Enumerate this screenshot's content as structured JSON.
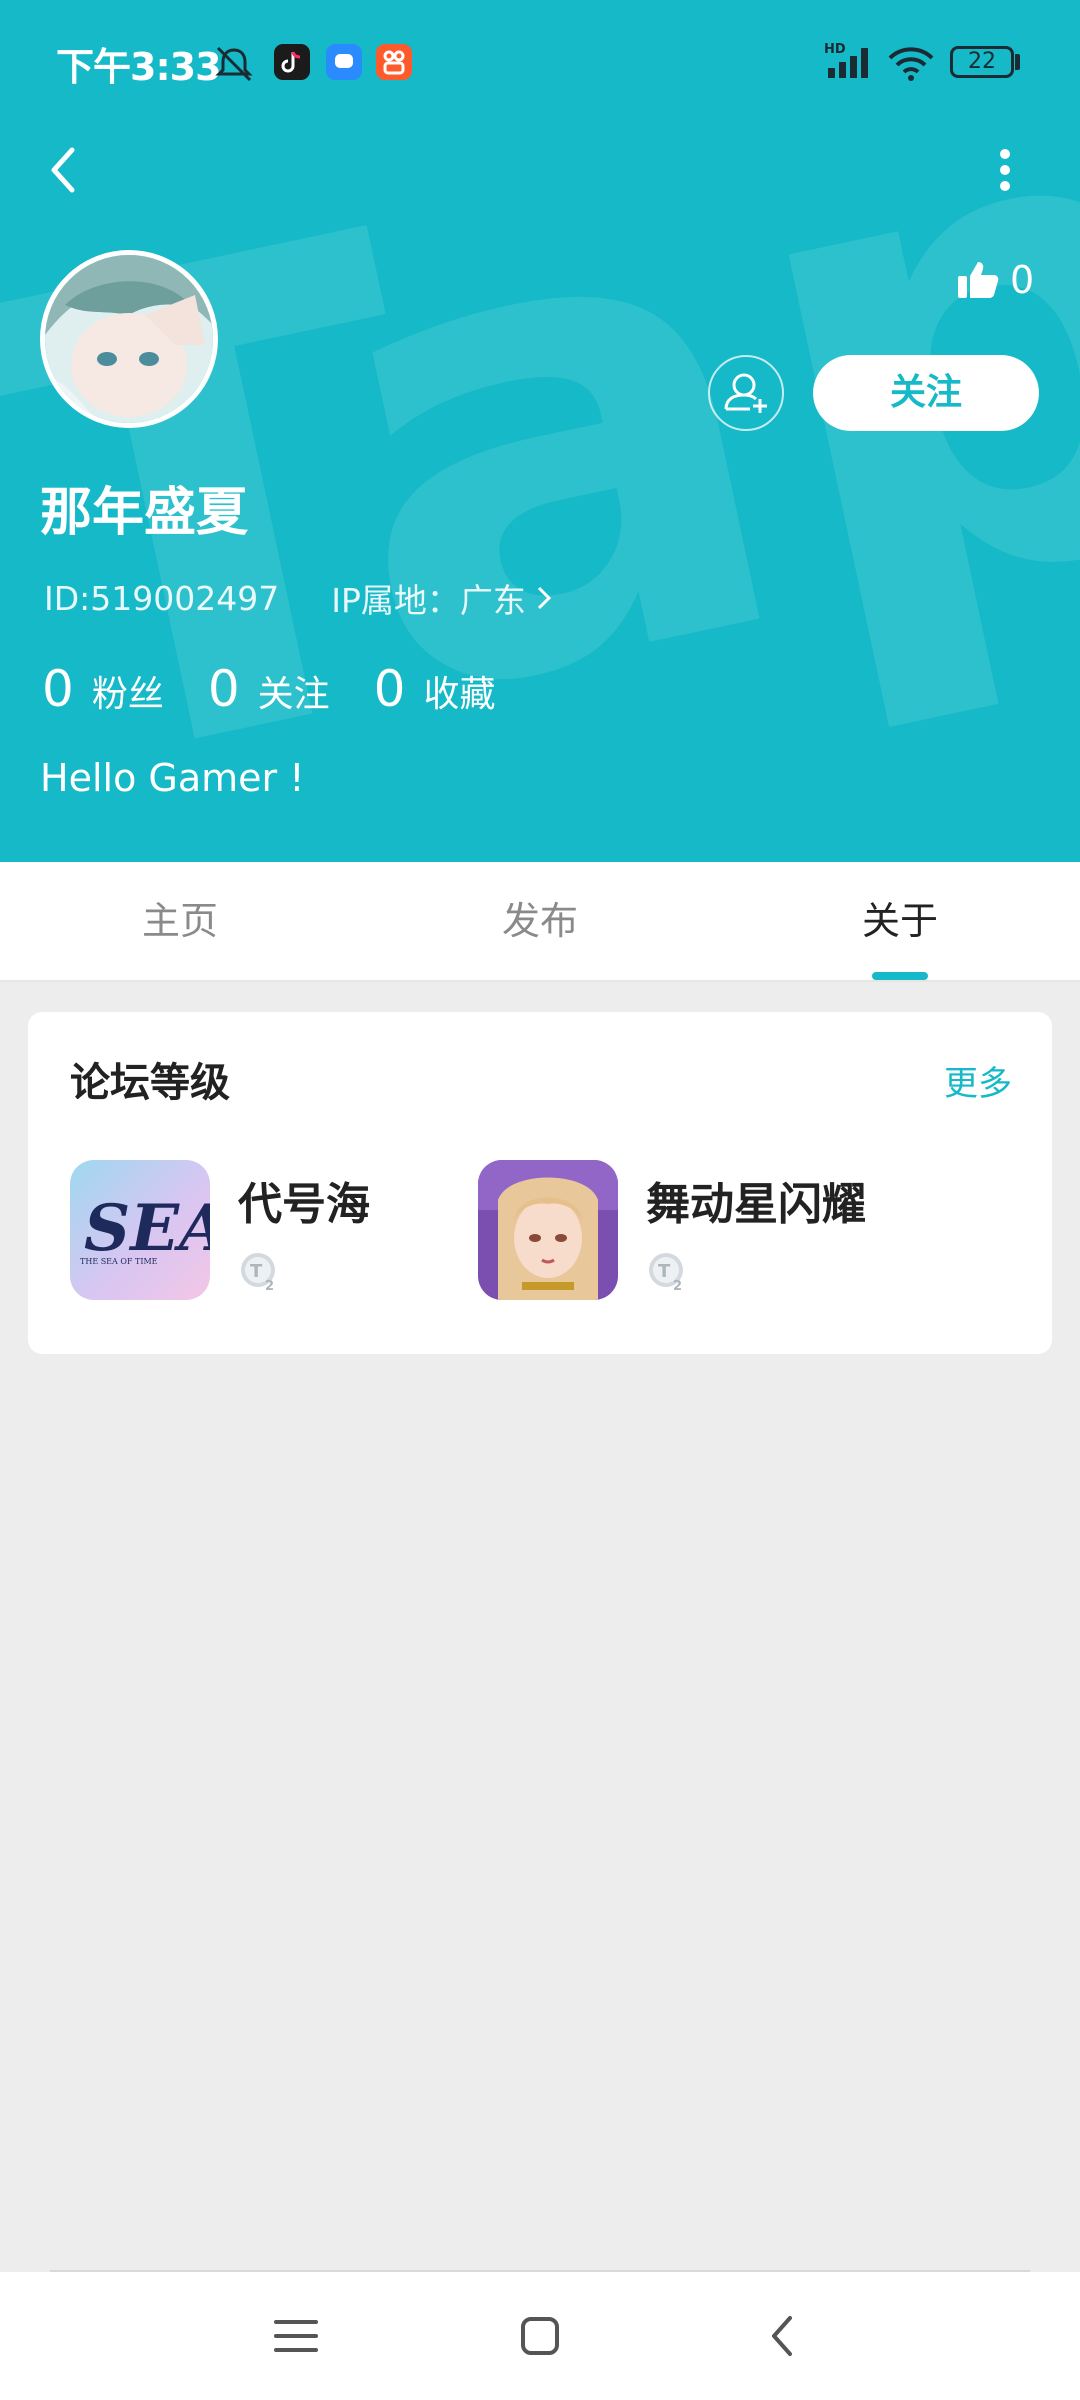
{
  "status_bar": {
    "time": "下午3:33",
    "signal_tag": "HD",
    "battery": "22"
  },
  "header": {
    "watermark_text": "TapTap",
    "like_count": "0",
    "follow_label": "关注",
    "username": "那年盛夏",
    "id_text": "ID:519002497",
    "ip_text": "IP属地：广东",
    "stats": [
      {
        "value": "0",
        "label": "粉丝"
      },
      {
        "value": "0",
        "label": "关注"
      },
      {
        "value": "0",
        "label": "收藏"
      }
    ],
    "bio": "Hello Gamer !"
  },
  "tabs": [
    {
      "label": "主页",
      "active": false
    },
    {
      "label": "发布",
      "active": false
    },
    {
      "label": "关于",
      "active": true
    }
  ],
  "forum_card": {
    "title": "论坛等级",
    "more_label": "更多",
    "games": [
      {
        "name": "代号海",
        "icon_text": "SEA",
        "icon_subtext": "THE SEA OF TIME",
        "level": "T2"
      },
      {
        "name": "舞动星闪耀",
        "level": "T2"
      }
    ]
  },
  "colors": {
    "brand": "#16B9C8",
    "page_bg": "#EDEDED"
  },
  "icons": [
    "back-icon",
    "more-vertical-icon",
    "thumbs-up-icon",
    "add-friend-icon",
    "chevron-right-icon",
    "menu-icon",
    "home-icon",
    "nav-back-icon"
  ]
}
